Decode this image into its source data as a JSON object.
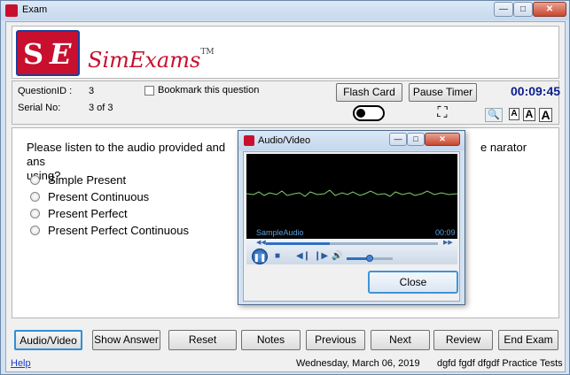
{
  "window": {
    "title": "Exam"
  },
  "logo": {
    "letter1": "S",
    "letter2": "E",
    "brand": "SimExams",
    "trademark": "TM"
  },
  "info": {
    "question_id_label": "QuestionID :",
    "question_id_value": "3",
    "serial_label": "Serial No:",
    "serial_value": "3 of 3",
    "bookmark_label": "Bookmark this question",
    "flash_card_label": "Flash Card",
    "pause_timer_label": "Pause Timer",
    "timer": "00:09:45",
    "font_small": "A",
    "font_medium": "A",
    "font_large": "A"
  },
  "question": {
    "text": "Please listen to the audio provided and ans",
    "text_tail": "e narator",
    "text_line2": "using?",
    "options": [
      {
        "label": "Simple Present"
      },
      {
        "label": "Present Continuous"
      },
      {
        "label": "Present Perfect"
      },
      {
        "label": "Present Perfect Continuous"
      }
    ]
  },
  "buttons": {
    "audio_video": "Audio/Video",
    "show_answer": "Show Answer",
    "reset": "Reset",
    "notes": "Notes",
    "previous": "Previous",
    "next": "Next",
    "review": "Review",
    "end_exam": "End Exam"
  },
  "status": {
    "help": "Help",
    "date": "Wednesday, March 06, 2019",
    "brand": "dgfd fgdf dfgdf Practice Tests"
  },
  "dialog": {
    "title": "Audio/Video",
    "media_name": "SampleAudio",
    "media_time": "00:09",
    "close_label": "Close",
    "seek_progress": 0.37,
    "volume": 0.5
  },
  "colors": {
    "timer": "#0a1e8c",
    "logo_red": "#c8102e",
    "waveform": "#7fd06a"
  }
}
